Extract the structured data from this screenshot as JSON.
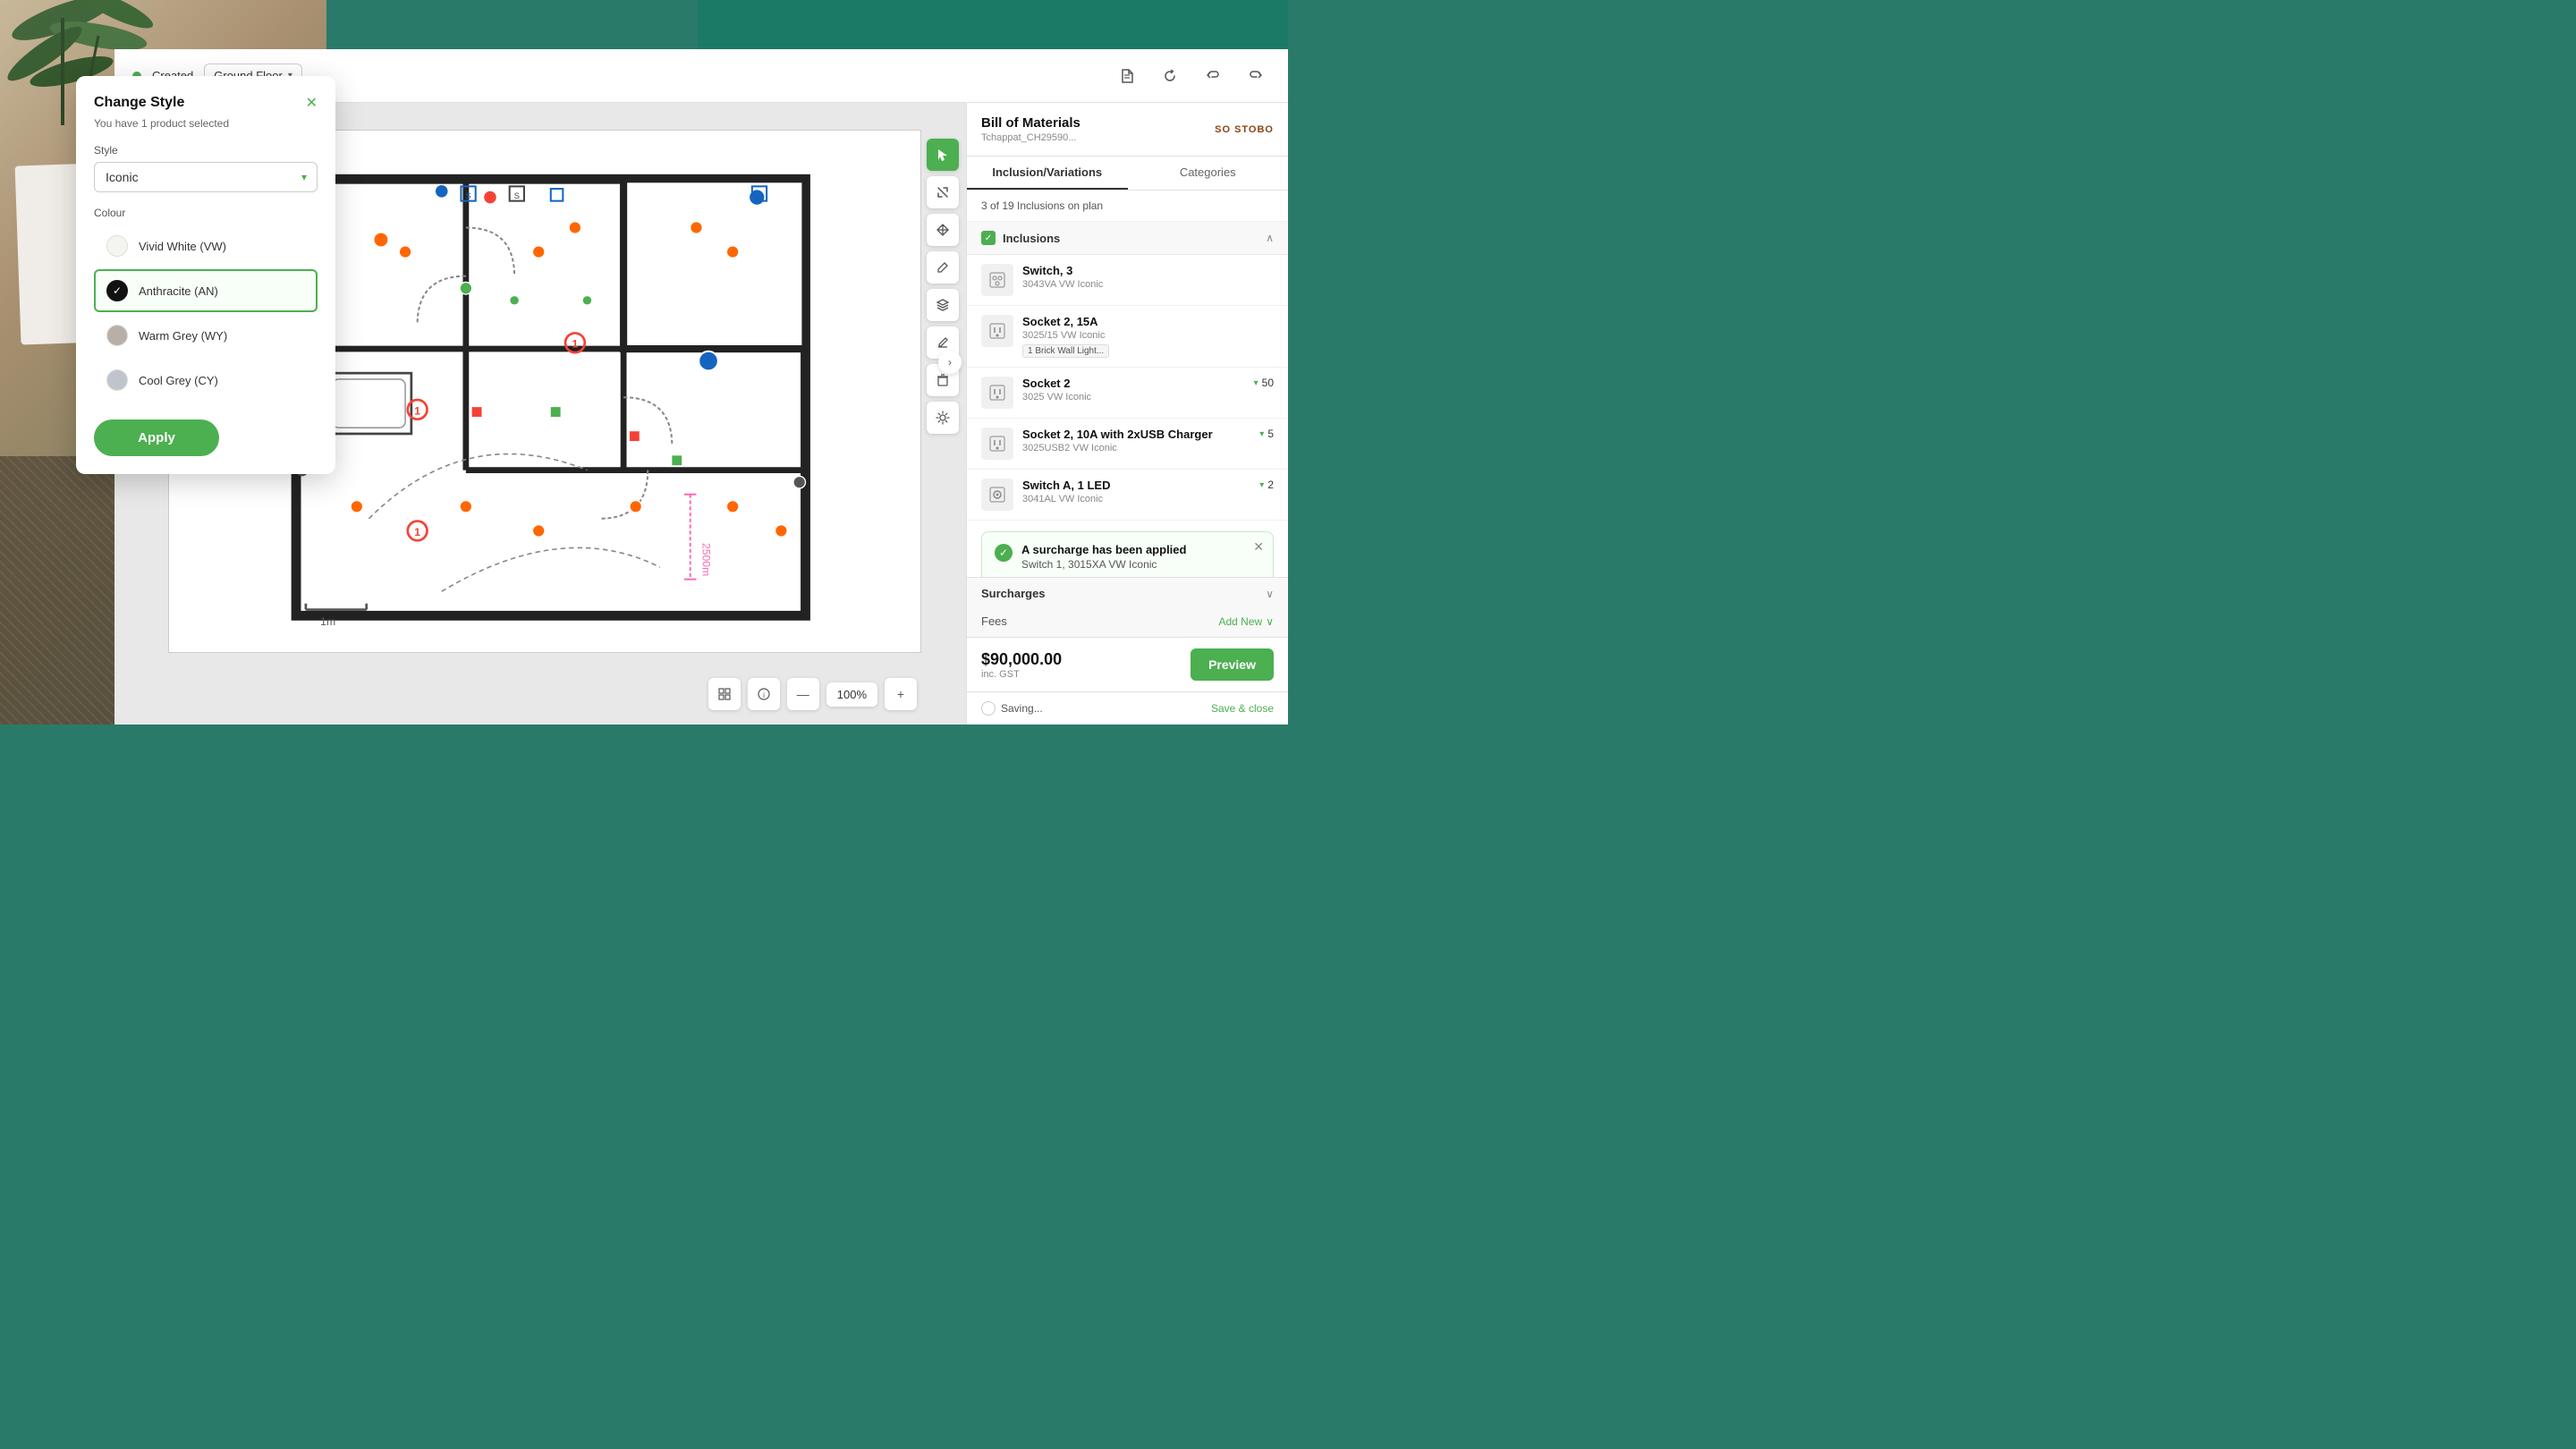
{
  "background": {
    "alt": "desk with plant and papers"
  },
  "header": {
    "status_label": "Created",
    "floor_label": "Ground Floor",
    "icons": [
      "document",
      "refresh",
      "undo",
      "redo"
    ]
  },
  "bom_panel": {
    "title": "Bill of Materials",
    "subtitle": "Tchappat_CH29590...",
    "logo": "SO STOBO",
    "tabs": [
      {
        "label": "Inclusion/Variations",
        "active": true
      },
      {
        "label": "Categories",
        "active": false
      }
    ],
    "count_label": "3 of 19 Inclusions on plan",
    "inclusions_section": {
      "label": "Inclusions",
      "items": [
        {
          "name": "Switch, 3",
          "code": "3043VA  VW  Iconic",
          "tag": null,
          "count": null
        },
        {
          "name": "Socket 2, 15A",
          "code": "3025/15  VW  Iconic",
          "tag": "1  Brick Wall Light...",
          "count": null
        },
        {
          "name": "Socket 2",
          "code": "3025  VW  Iconic",
          "tag": null,
          "count": "▾ 50"
        },
        {
          "name": "Socket 2, 10A with 2xUSB Charger",
          "code": "3025USB2  VW  Iconic",
          "tag": null,
          "count": "▾ 5"
        },
        {
          "name": "Switch A, 1 LED",
          "code": "3041AL  VW  Iconic",
          "tag": null,
          "count": "▾ 2"
        }
      ]
    },
    "surcharge_banner": {
      "title": "A surcharge has been applied",
      "description": "Switch 1, 3015XA  VW  Iconic"
    },
    "surcharges_label": "Surcharges",
    "fees_label": "Fees",
    "fees_add": "Add New",
    "price": "$90,000.00",
    "price_gst": "inc. GST",
    "preview_label": "Preview",
    "saving_label": "Saving...",
    "save_close_label": "Save & close"
  },
  "change_style_modal": {
    "title": "Change Style",
    "subtitle": "You have 1 product selected",
    "style_label": "Style",
    "style_value": "Iconic",
    "colour_label": "Colour",
    "colours": [
      {
        "name": "Vivid White (VW)",
        "swatch": "#f5f5f0",
        "selected": false
      },
      {
        "name": "Anthracite (AN)",
        "swatch": "#222222",
        "selected": true
      },
      {
        "name": "Warm Grey (WY)",
        "swatch": "#b8b0a8",
        "selected": false
      },
      {
        "name": "Cool Grey (CY)",
        "swatch": "#c0c4cc",
        "selected": false
      }
    ],
    "apply_label": "Apply"
  },
  "canvas": {
    "zoom": "100%",
    "scale": "1m"
  }
}
